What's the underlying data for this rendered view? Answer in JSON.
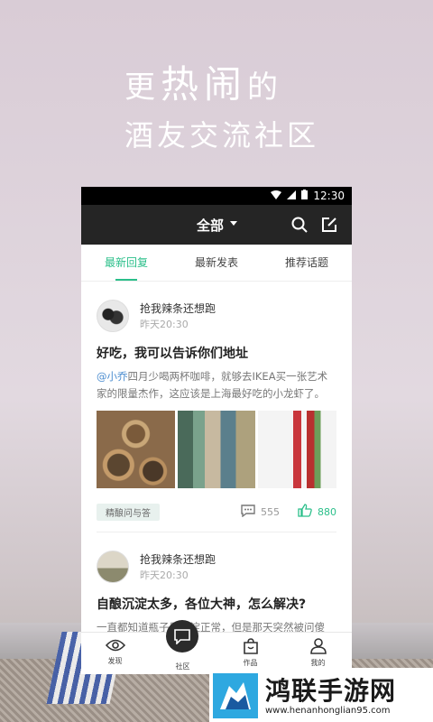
{
  "promo": {
    "line1_pre": "更",
    "line1_big": "热闹",
    "line1_post": "的",
    "line2": "酒友交流社区"
  },
  "statusbar": {
    "time": "12:30"
  },
  "topbar": {
    "title": "全部"
  },
  "tabs": [
    {
      "label": "最新回复"
    },
    {
      "label": "最新发表"
    },
    {
      "label": "推荐话题"
    }
  ],
  "posts": [
    {
      "author": "抢我辣条还想跑",
      "time": "昨天20:30",
      "title": "好吃，我可以告诉你们地址",
      "mention": "@小乔",
      "body": "四月少喝两杯咖啡，就够去IKEA买一张艺术家的限量杰作，这应该是上海最好吃的小龙虾了。",
      "tag": "精酿问与答",
      "comments": "555",
      "likes": "880"
    },
    {
      "author": "抢我辣条还想跑",
      "time": "昨天20:30",
      "title": "自酿沉淀太多，各位大神，怎么解决?",
      "body": "一直都知道瓶子里沉淀正常，但是那天突然被问傻了，说瓶子里的沉淀物到底是什么物质?"
    }
  ],
  "bottomnav": [
    {
      "label": "发现",
      "icon": "eye-icon"
    },
    {
      "label": "社区",
      "icon": "chat-bubble-icon"
    },
    {
      "label": "作品",
      "icon": "bag-icon"
    },
    {
      "label": "我的",
      "icon": "person-icon"
    }
  ],
  "watermark": {
    "title": "鸿联手游网",
    "url": "www.henanhonglian95.com"
  },
  "colors": {
    "accent": "#2bbf8a",
    "dark": "#252525",
    "mention": "#4a8ccf"
  }
}
